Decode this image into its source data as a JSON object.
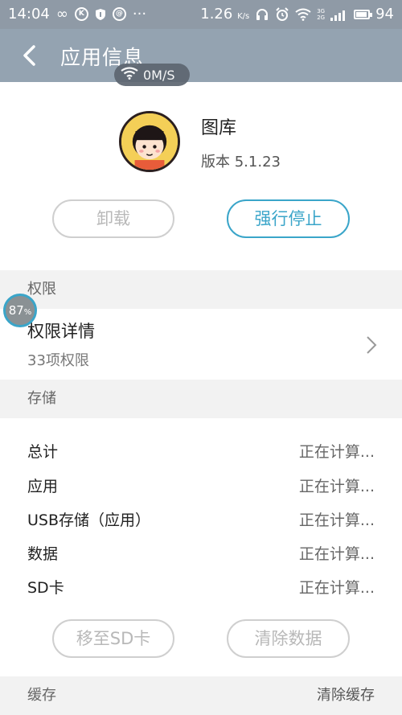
{
  "status_bar": {
    "time": "14:04",
    "speed": "1.26",
    "speed_unit": "K/s",
    "network_labels": [
      "3G",
      "2G"
    ],
    "battery": "94",
    "icons": [
      "infinity-icon",
      "k-circle-icon",
      "shield-icon",
      "at-circle-icon",
      "more-icon",
      "headphones-icon",
      "alarm-icon",
      "wifi-icon",
      "signal-icon",
      "battery-icon"
    ]
  },
  "header": {
    "title": "应用信息",
    "back_icon": "chevron-left-icon"
  },
  "network_speed_overlay": "0M/S",
  "app": {
    "name": "图库",
    "version": "版本 5.1.23"
  },
  "actions": {
    "uninstall": "卸载",
    "force_stop": "强行停止"
  },
  "permissions": {
    "header": "权限",
    "row_title": "权限详情",
    "row_subtitle": "33项权限"
  },
  "floating_badge": {
    "value": "87",
    "unit": "%"
  },
  "storage": {
    "header": "存储",
    "rows": [
      {
        "label": "总计",
        "value": "正在计算..."
      },
      {
        "label": "应用",
        "value": "正在计算..."
      },
      {
        "label": "USB存储（应用）",
        "value": "正在计算..."
      },
      {
        "label": "数据",
        "value": "正在计算..."
      },
      {
        "label": "SD卡",
        "value": "正在计算..."
      }
    ],
    "move_button": "移至SD卡",
    "clear_button": "清除数据"
  },
  "cache": {
    "header": "缓存",
    "action": "清除缓存"
  },
  "colors": {
    "accent": "#3aa5c9",
    "header_bg": "#94a3b1",
    "section_bg": "#f2f2f2"
  }
}
